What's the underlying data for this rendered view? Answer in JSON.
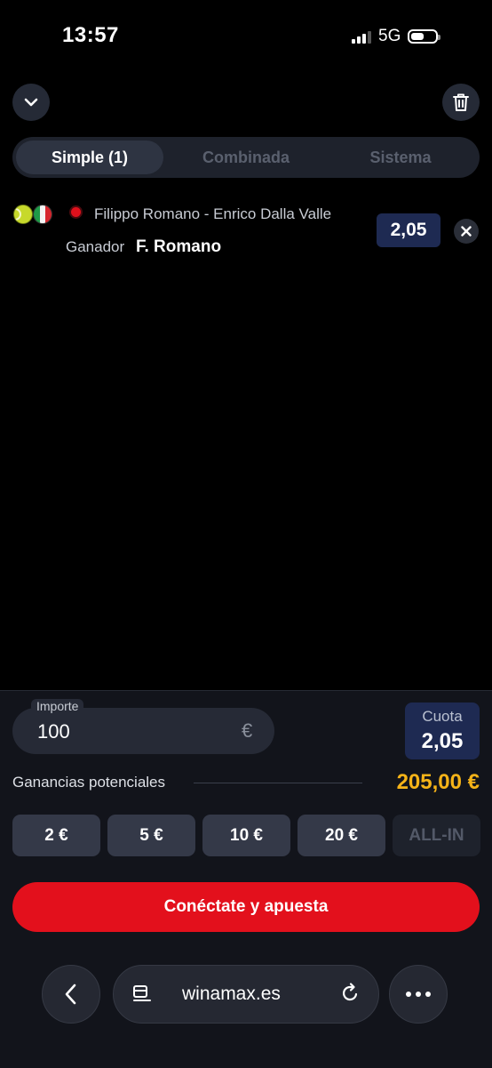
{
  "status_bar": {
    "time": "13:57",
    "network": "5G"
  },
  "tabs": [
    {
      "label": "Simple (1)",
      "active": true
    },
    {
      "label": "Combinada",
      "active": false
    },
    {
      "label": "Sistema",
      "active": false
    }
  ],
  "bet": {
    "sport_icon": "tennis-ball-icon",
    "country_icon": "italy-flag-icon",
    "live": true,
    "match": "Filippo Romano - Enrico Dalla Valle",
    "market": "Ganador",
    "selection": "F. Romano",
    "odds": "2,05"
  },
  "stake": {
    "label": "Importe",
    "value": "100",
    "currency": "€",
    "cuota_label": "Cuota",
    "cuota_value": "2,05"
  },
  "gains": {
    "label": "Ganancias potenciales",
    "value": "205,00 €"
  },
  "quick_amounts": [
    "2 €",
    "5 €",
    "10 €",
    "20 €",
    "ALL-IN"
  ],
  "cta": {
    "label": "Conéctate y apuesta"
  },
  "browser": {
    "url": "winamax.es"
  },
  "colors": {
    "accent_red": "#e3101c",
    "gains_yellow": "#f5b318",
    "odds_navy": "#1e2a52"
  }
}
